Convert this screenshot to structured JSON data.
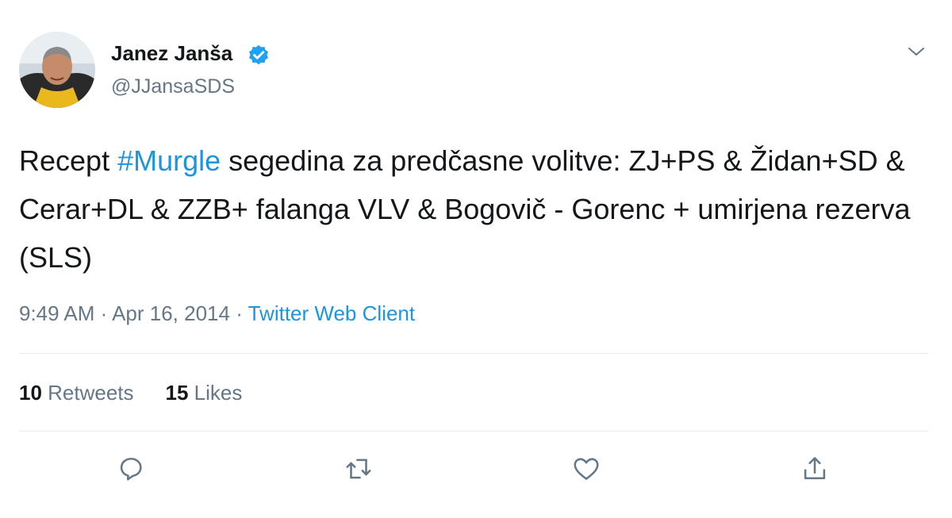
{
  "author": {
    "display_name": "Janez Janša",
    "handle": "@JJansaSDS",
    "verified_icon": "verified-badge-icon",
    "avatar": "profile-photo"
  },
  "menu": {
    "icon": "chevron-down-icon"
  },
  "tweet": {
    "text_before": "Recept ",
    "hashtag": "#Murgle",
    "text_after": " segedina za predčasne volitve: ZJ+PS & Židan+SD & Cerar+DL & ZZB+ falanga VLV & Bogovič - Gorenc + umirjena rezerva (SLS)",
    "time": "9:49 AM",
    "separator": " · ",
    "date": "Apr 16, 2014",
    "source": "Twitter Web Client"
  },
  "stats": {
    "retweets_count": "10",
    "retweets_label": " Retweets",
    "likes_count": "15",
    "likes_label": " Likes"
  },
  "actions": [
    {
      "icon": "reply-icon"
    },
    {
      "icon": "retweet-icon"
    },
    {
      "icon": "like-heart-icon"
    },
    {
      "icon": "share-icon"
    }
  ],
  "colors": {
    "link_blue": "#1b95e0",
    "text_primary": "#14171a",
    "text_secondary": "#657786",
    "divider": "#e6ecf0",
    "verified_blue": "#1da1f2"
  }
}
